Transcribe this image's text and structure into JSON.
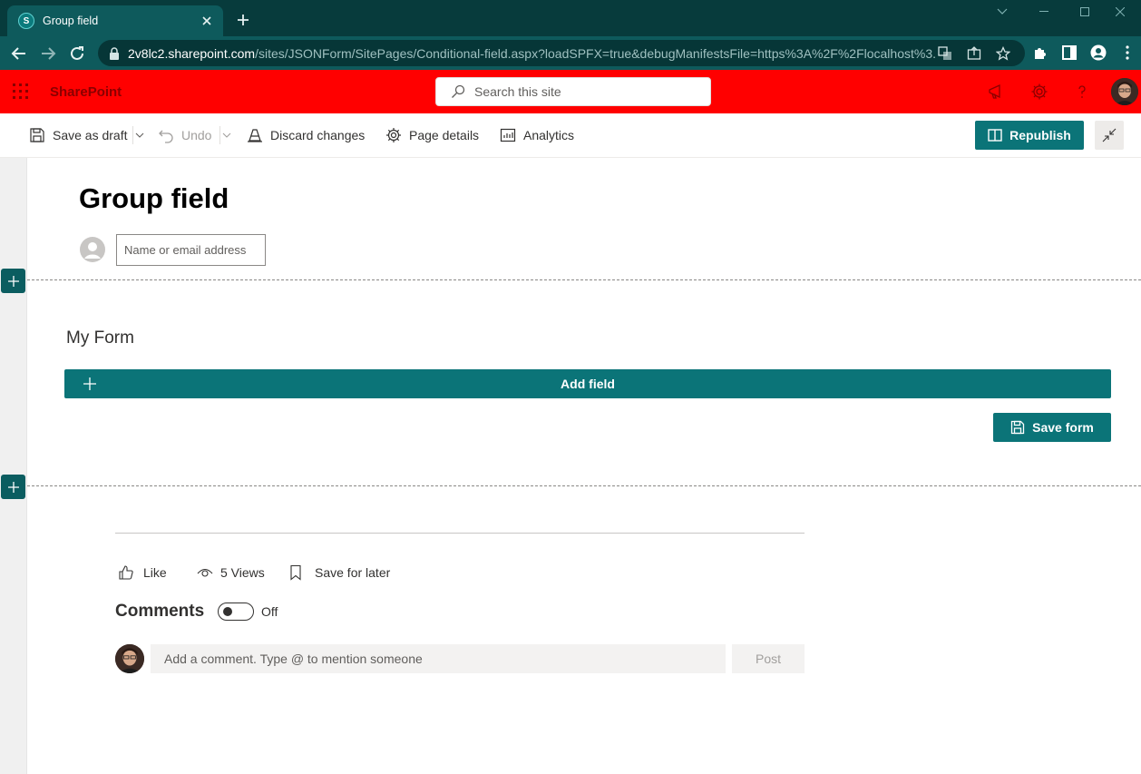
{
  "browser": {
    "tab_title": "Group field",
    "url_host": "2v8lc2.sharepoint.com",
    "url_path": "/sites/JSONForm/SitePages/Conditional-field.aspx?loadSPFX=true&debugManifestsFile=https%3A%2F%2Flocalhost%3..."
  },
  "suitebar": {
    "brand": "SharePoint",
    "search_placeholder": "Search this site",
    "bg_color": "#ff0000"
  },
  "commandbar": {
    "save_draft": "Save as draft",
    "undo": "Undo",
    "discard": "Discard changes",
    "page_details": "Page details",
    "analytics": "Analytics",
    "republish": "Republish"
  },
  "page": {
    "title": "Group field",
    "author_placeholder": "Name or email address"
  },
  "form": {
    "title": "My Form",
    "add_field": "Add field",
    "save_form": "Save form",
    "accent_color": "#0b7478"
  },
  "social": {
    "like": "Like",
    "views": "5 Views",
    "save_later": "Save for later"
  },
  "comments": {
    "title": "Comments",
    "toggle_state": "Off",
    "placeholder": "Add a comment. Type @ to mention someone",
    "post": "Post"
  }
}
